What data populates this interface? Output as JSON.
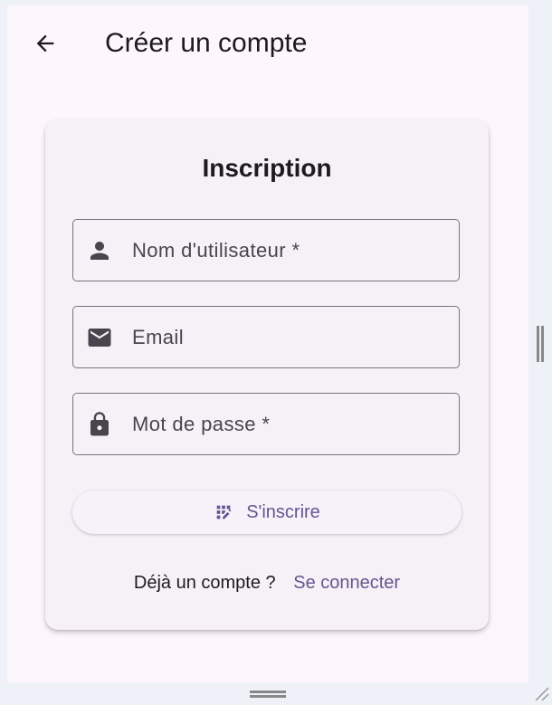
{
  "appbar": {
    "title": "Créer un compte",
    "back_icon": "arrow-back-icon"
  },
  "card": {
    "title": "Inscription"
  },
  "fields": {
    "username": {
      "label": "Nom d'utilisateur *",
      "icon": "person-icon"
    },
    "email": {
      "label": "Email",
      "icon": "mail-icon"
    },
    "password": {
      "label": "Mot de passe *",
      "icon": "lock-icon"
    }
  },
  "submit": {
    "label": "S'inscrire",
    "icon": "app-registration-icon"
  },
  "footer": {
    "text": "Déjà un compte ?",
    "link": "Se connecter"
  },
  "colors": {
    "background": "#fdf6fd",
    "card": "#f6f1f7",
    "primary": "#65558f",
    "text": "#1d1b20",
    "outline": "#79747e",
    "icon": "#49454f"
  }
}
